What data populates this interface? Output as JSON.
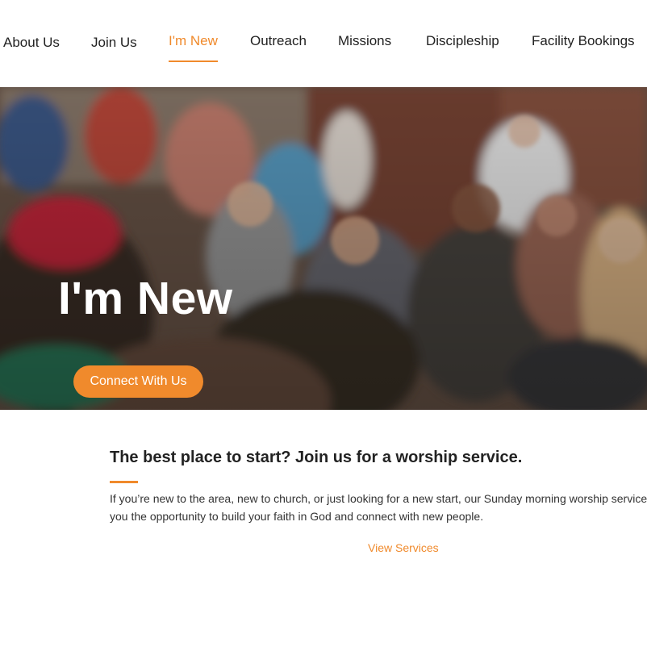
{
  "nav": {
    "items": [
      {
        "label": "About Us"
      },
      {
        "label": "Join Us"
      },
      {
        "label": "I'm New",
        "active": true
      },
      {
        "label": "Outreach"
      },
      {
        "label": "Missions"
      },
      {
        "label": "Discipleship"
      },
      {
        "label": "Facility Bookings"
      }
    ]
  },
  "hero": {
    "title": "I'm New",
    "button_label": "Connect With Us"
  },
  "intro": {
    "heading": "The best place to start? Join us for a worship service.",
    "paragraph_line1": "If you’re new to the area, new to church, or just looking for a new start, our Sunday morning worship services",
    "paragraph_line2": "you the opportunity to build your faith in God and connect with new people.",
    "link_label": "View Services"
  },
  "colors": {
    "accent": "#f08a2c",
    "text": "#222222",
    "background": "#ffffff"
  }
}
